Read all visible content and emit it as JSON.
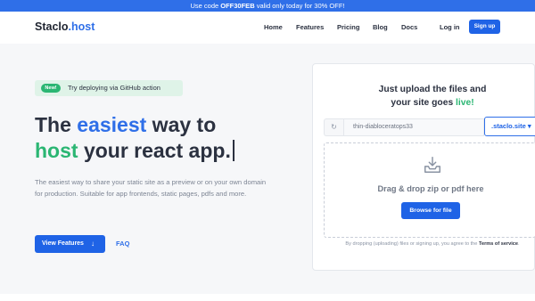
{
  "promo": {
    "prefix": "Use code ",
    "code": "OFF30FEB",
    "suffix": " valid only today for 30% OFF!",
    "bg_color": "#2f6fe8"
  },
  "nav": {
    "logo_main": "Staclo",
    "logo_dot": ".host",
    "links": [
      "Home",
      "Features",
      "Pricing",
      "Blog",
      "Docs"
    ],
    "login": "Log in",
    "signup": "Sign up"
  },
  "hero": {
    "badge_pill": "New!",
    "badge_text": "Try deploying via GitHub action",
    "headline_1a": "The ",
    "headline_1b": "easiest",
    "headline_1c": " way to",
    "headline_2a": "host",
    "headline_2b": " your react app.",
    "description": "The easiest way to share your static site as a preview or on your own domain for production. Suitable for app frontends, static pages, pdfs and more.",
    "features_button": "View Features",
    "features_arrow": "↓",
    "faq_link": "FAQ"
  },
  "upload_card": {
    "title_line1": "Just upload the files and",
    "title_line2_a": "your site goes ",
    "title_line2_b": "live!",
    "refresh_icon": "↻",
    "subdomain_value": "thin-diabloceratops33",
    "domain_option": ".staclo.site ▾",
    "drop_text": "Drag & drop zip or pdf here",
    "browse_button": "Browse for file",
    "terms_prefix": "By dropping (uploading) files or signing up, you agree to the ",
    "terms_link": "Terms of service",
    "terms_suffix": "."
  },
  "colors": {
    "accent_blue": "#2f6fe8",
    "accent_green": "#2bb673",
    "button_blue": "#1f63e6"
  }
}
